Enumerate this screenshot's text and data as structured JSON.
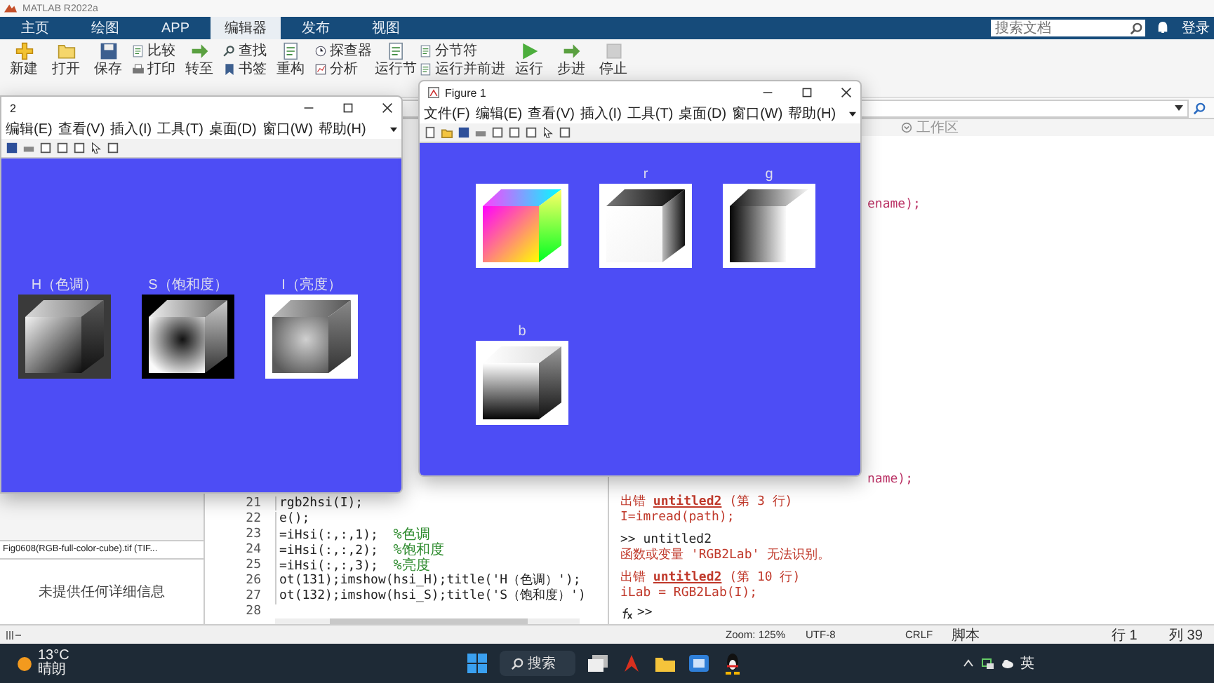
{
  "window": {
    "title": "MATLAB R2022a"
  },
  "tabs": [
    {
      "label": "主页",
      "selected": false
    },
    {
      "label": "绘图",
      "selected": false
    },
    {
      "label": "APP",
      "selected": false
    },
    {
      "label": "编辑器",
      "selected": true
    },
    {
      "label": "发布",
      "selected": false
    },
    {
      "label": "视图",
      "selected": false
    }
  ],
  "search": {
    "placeholder": "搜索文档"
  },
  "sign_in": "登录",
  "toolstrip": [
    {
      "kind": "large",
      "label": "新建"
    },
    {
      "kind": "large",
      "label": "打开"
    },
    {
      "kind": "large",
      "label": "保存"
    },
    {
      "kind": "small",
      "label": "比较"
    },
    {
      "kind": "small",
      "label": "打印"
    },
    {
      "kind": "large",
      "label": "转至"
    },
    {
      "kind": "small",
      "label": "查找"
    },
    {
      "kind": "small",
      "label": "书签"
    },
    {
      "kind": "large",
      "label": "重构"
    },
    {
      "kind": "small",
      "label": "探查器"
    },
    {
      "kind": "small",
      "label": "分析"
    },
    {
      "kind": "large",
      "label": "运行节"
    },
    {
      "kind": "small",
      "label": "分节符"
    },
    {
      "kind": "small",
      "label": "运行并前进"
    },
    {
      "kind": "large",
      "label": "运行"
    },
    {
      "kind": "large",
      "label": "步进"
    },
    {
      "kind": "large",
      "label": "停止"
    }
  ],
  "folder_panel": {
    "file": "Fig0608(RGB-full-color-cube).tif  (TIF...",
    "details": "未提供任何详细信息"
  },
  "workspace": {
    "title": "工作区"
  },
  "editor": {
    "lines": [
      {
        "num": "21",
        "code": "rgb2hsi(I);"
      },
      {
        "num": "22",
        "code": "e();"
      },
      {
        "num": "23",
        "code": "=iHsi(:,:,1);  ",
        "comment": "%色调"
      },
      {
        "num": "24",
        "code": "=iHsi(:,:,2);  ",
        "comment": "%饱和度"
      },
      {
        "num": "25",
        "code": "=iHsi(:,:,3);  ",
        "comment": "%亮度"
      },
      {
        "num": "26",
        "code": "ot(131);imshow(hsi_H);title('H（色调）');"
      },
      {
        "num": "27",
        "code": "ot(132);imshow(hsi_S);title('S（饱和度）')"
      },
      {
        "num": "28"
      }
    ]
  },
  "command_window": {
    "lines": [
      {
        "kind": "fragment",
        "text": "ename);"
      },
      {
        "kind": "fragment",
        "text": "name);"
      },
      {
        "kind": "error_at",
        "prefix": "出错 ",
        "link": "untitled2",
        "location": " (第 3 行)"
      },
      {
        "kind": "error",
        "text": "I=imread(path);"
      },
      {
        "kind": "command",
        "text": ">> untitled2"
      },
      {
        "kind": "error",
        "text": "函数或变量 'RGB2Lab' 无法识别。"
      },
      {
        "kind": "error_at",
        "prefix": "出错 ",
        "link": "untitled2",
        "location": " (第 10 行)"
      },
      {
        "kind": "error",
        "text": "iLab = RGB2Lab(I);"
      }
    ],
    "prompt": ">>"
  },
  "figures": [
    {
      "title": "2",
      "menu": [
        "编辑(E)",
        "查看(V)",
        "插入(I)",
        "工具(T)",
        "桌面(D)",
        "窗口(W)",
        "帮助(H)"
      ],
      "axes": [
        {
          "title": "H（色调）",
          "kind": "picture"
        },
        {
          "title": "S（饱和度）",
          "kind": "picture"
        },
        {
          "title": "I（亮度）",
          "kind": "picture"
        }
      ]
    },
    {
      "title": "Figure 1",
      "menu": [
        "文件(F)",
        "编辑(E)",
        "查看(V)",
        "插入(I)",
        "工具(T)",
        "桌面(D)",
        "窗口(W)",
        "帮助(H)"
      ],
      "axes": [
        {
          "kind": "picture"
        },
        {
          "title": "r",
          "kind": "picture"
        },
        {
          "title": "g",
          "kind": "picture"
        },
        {
          "title": "b",
          "kind": "picture"
        }
      ]
    }
  ],
  "status_bar": [
    "Zoom: 125%",
    "UTF-8",
    "CRLF",
    "脚本",
    "行 1",
    "列 39"
  ],
  "taskbar": {
    "weather": {
      "temp": "13°C",
      "condition": "晴朗"
    },
    "search": "搜索",
    "input_method": "英"
  }
}
